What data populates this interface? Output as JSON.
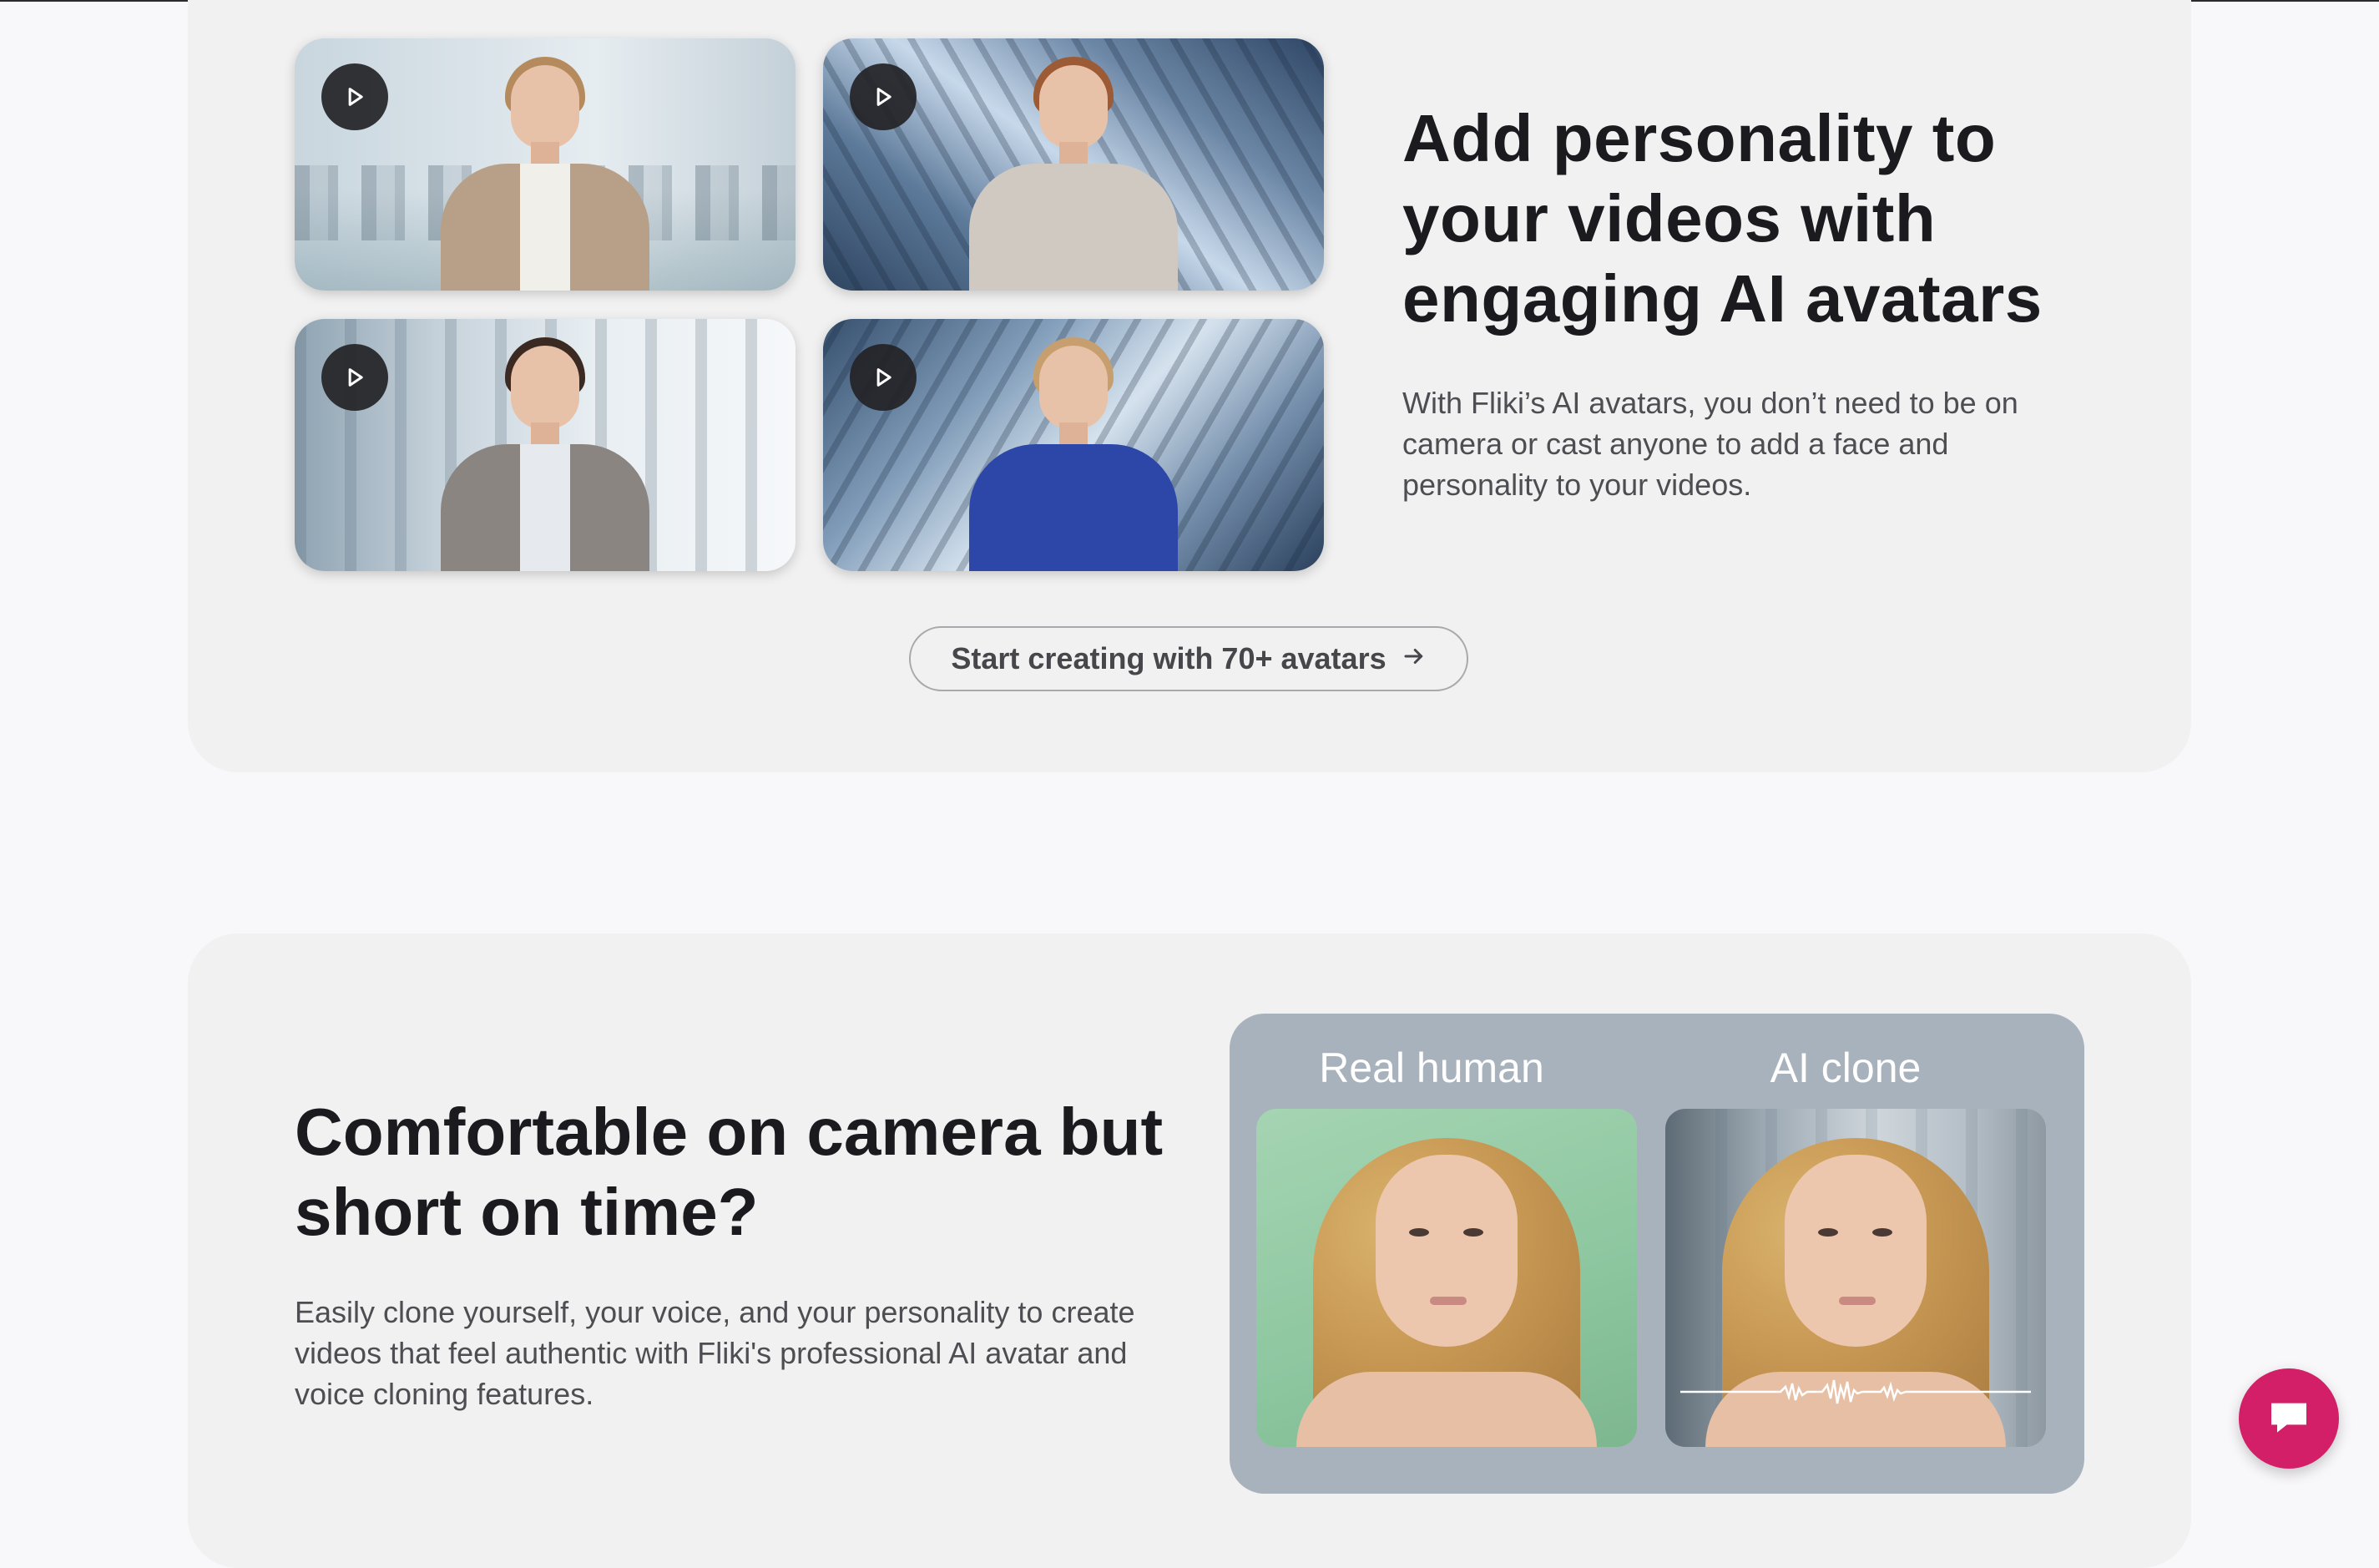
{
  "avatars_section": {
    "headline": "Add personality to your videos with engaging AI avatars",
    "description": "With Fliki’s AI avatars, you don’t need to be on camera or cast anyone to add a face and personality to your videos.",
    "cta_label": "Start creating with 70+ avatars",
    "cta_icon": "arrow-right-icon",
    "videos": [
      {
        "icon": "play-icon"
      },
      {
        "icon": "play-icon"
      },
      {
        "icon": "play-icon"
      },
      {
        "icon": "play-icon"
      }
    ]
  },
  "clone_section": {
    "headline": "Comfortable on camera but short on time?",
    "description": "Easily clone yourself, your voice, and your personality to create videos that feel authentic with Fliki's professional AI avatar and voice cloning features.",
    "compare": {
      "left_label": "Real human",
      "right_label": "AI clone"
    }
  },
  "chat": {
    "icon": "chat-bubble-icon",
    "color": "#d21f67"
  }
}
